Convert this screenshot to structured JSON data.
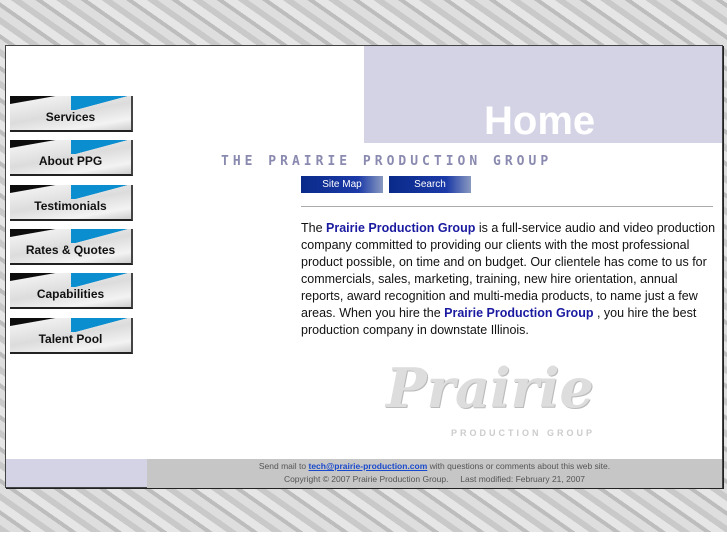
{
  "header": {
    "title": "Home",
    "tagline": "THE PRAIRIE PRODUCTION GROUP"
  },
  "nav": [
    {
      "label": "Services"
    },
    {
      "label": "About PPG"
    },
    {
      "label": "Testimonials"
    },
    {
      "label": "Rates & Quotes"
    },
    {
      "label": "Capabilities"
    },
    {
      "label": "Talent Pool"
    }
  ],
  "buttons": {
    "site_map": "Site Map",
    "search": "Search"
  },
  "content": {
    "p1": "The ",
    "brand1": "Prairie Production Group",
    "p2": " is a full-service audio and video production company committed to providing our clients with the most professional product possible, on time and on budget. Our clientele has come to us for commercials, sales, marketing, training, new hire orientation, annual reports, award recognition and multi-media products, to name just a few areas. When you hire the ",
    "brand2": "Prairie Production Group",
    "p3": " , you hire the best production company in downstate Illinois."
  },
  "logo": {
    "text": "Prairie",
    "sub": "PRODUCTION GROUP"
  },
  "footer": {
    "send_prefix": "Send mail to ",
    "email": "tech@prairie-production.com",
    "send_suffix": " with questions or comments about this web site.",
    "copyright": "Copyright © 2007 Prairie Production Group.",
    "modified": "Last modified: February 21, 2007"
  }
}
